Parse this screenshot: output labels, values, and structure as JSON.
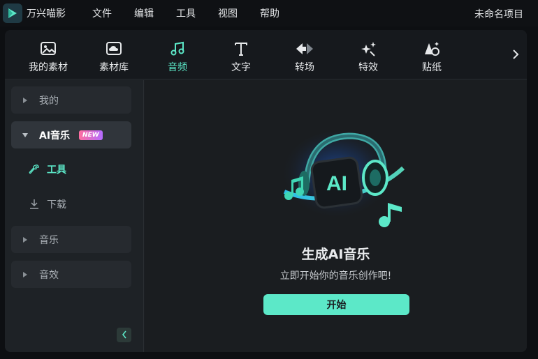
{
  "app": {
    "name": "万兴喵影",
    "project_name": "未命名项目"
  },
  "menu": [
    "文件",
    "编辑",
    "工具",
    "视图",
    "帮助"
  ],
  "toolbar": {
    "tabs": [
      {
        "label": "我的素材",
        "icon": "image-icon"
      },
      {
        "label": "素材库",
        "icon": "cloud-library-icon"
      },
      {
        "label": "音频",
        "icon": "music-note-icon",
        "active": true
      },
      {
        "label": "文字",
        "icon": "text-icon"
      },
      {
        "label": "转场",
        "icon": "transition-icon"
      },
      {
        "label": "特效",
        "icon": "effects-icon"
      },
      {
        "label": "贴纸",
        "icon": "sticker-icon"
      }
    ]
  },
  "sidebar": {
    "items": [
      {
        "label": "我的"
      },
      {
        "label": "AI音乐",
        "badge": "NEW",
        "expanded": true,
        "children": [
          {
            "label": "工具",
            "active": true
          },
          {
            "label": "下载"
          }
        ]
      },
      {
        "label": "音乐"
      },
      {
        "label": "音效"
      }
    ]
  },
  "content": {
    "hero_badge": "AI",
    "title": "生成AI音乐",
    "subtitle": "立即开始你的音乐创作吧!",
    "button": "开始"
  },
  "colors": {
    "accent": "#5ce8c8",
    "panel": "#1c1f23",
    "background": "#0d0f12"
  }
}
